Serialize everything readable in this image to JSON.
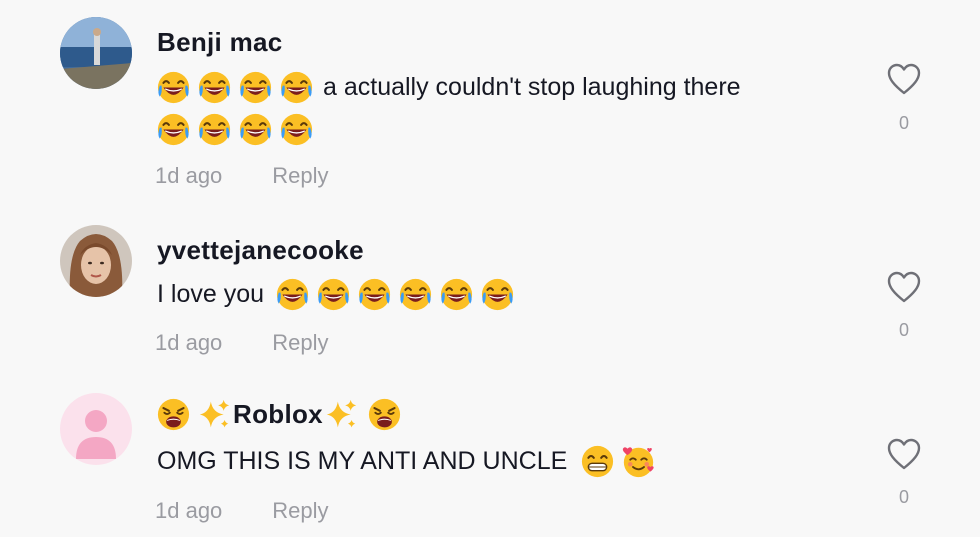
{
  "comments": [
    {
      "username": "Benji mac",
      "text_line1": "a actually couldn't stop laughing there",
      "time": "1d ago",
      "reply_label": "Reply",
      "like_count": "0"
    },
    {
      "username": "yvettejanecooke",
      "text": "I love you",
      "time": "1d ago",
      "reply_label": "Reply",
      "like_count": "0"
    },
    {
      "username": "Roblox",
      "text": "OMG THIS IS MY ANTI AND UNCLE",
      "time": "1d ago",
      "reply_label": "Reply",
      "like_count": "0"
    }
  ],
  "icons": {
    "laugh": "face-with-tears-of-joy-icon",
    "weary": "weary-face-icon",
    "sparkles": "sparkles-icon",
    "grin": "grinning-face-icon",
    "hearts": "smiling-face-with-hearts-icon",
    "like": "heart-outline-icon"
  },
  "colors": {
    "background": "#f8f8f8",
    "text": "#161823",
    "muted": "#9a9ba1",
    "emoji_yellow": "#fbbf24"
  }
}
